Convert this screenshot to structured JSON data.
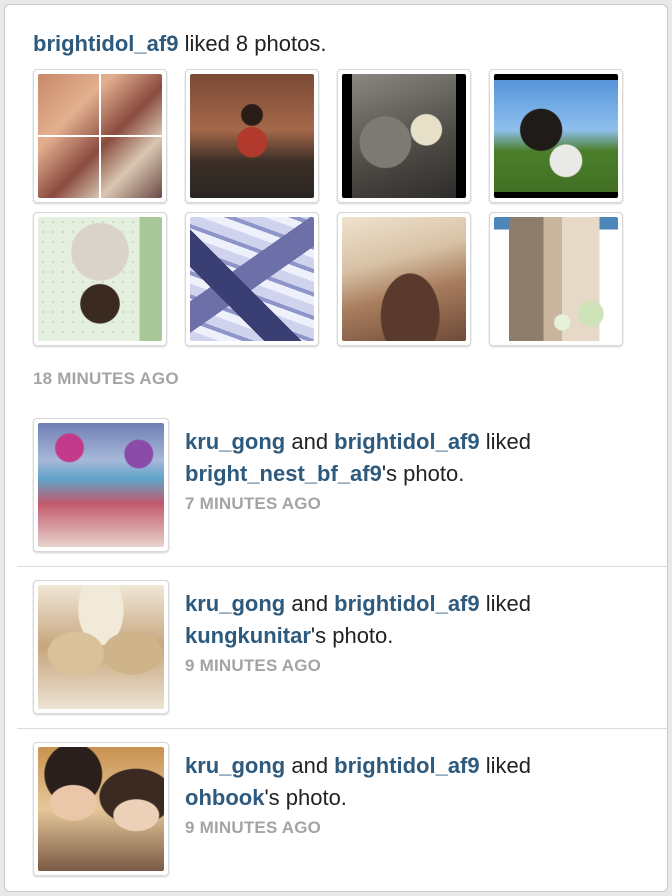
{
  "header": {
    "username": "brightidol_af9",
    "action_text": " liked 8 photos."
  },
  "grid_timestamp": "18 MINUTES AGO",
  "activities": [
    {
      "user1": "kru_gong",
      "and_text": " and ",
      "user2": "brightidol_af9",
      "liked_text": " liked",
      "owner": "bright_nest_bf_af9",
      "suffix": "'s photo.",
      "time": "7 MINUTES AGO"
    },
    {
      "user1": "kru_gong",
      "and_text": " and ",
      "user2": "brightidol_af9",
      "liked_text": " liked",
      "owner": "kungkunitar",
      "suffix": "'s photo.",
      "time": "9 MINUTES AGO"
    },
    {
      "user1": "kru_gong",
      "and_text": " and ",
      "user2": "brightidol_af9",
      "liked_text": " liked",
      "owner": "ohbook",
      "suffix": "'s photo.",
      "time": "9 MINUTES AGO"
    }
  ],
  "colors": {
    "username": "#2e5a7d",
    "timestamp": "#a4a4a4",
    "text": "#222222"
  }
}
